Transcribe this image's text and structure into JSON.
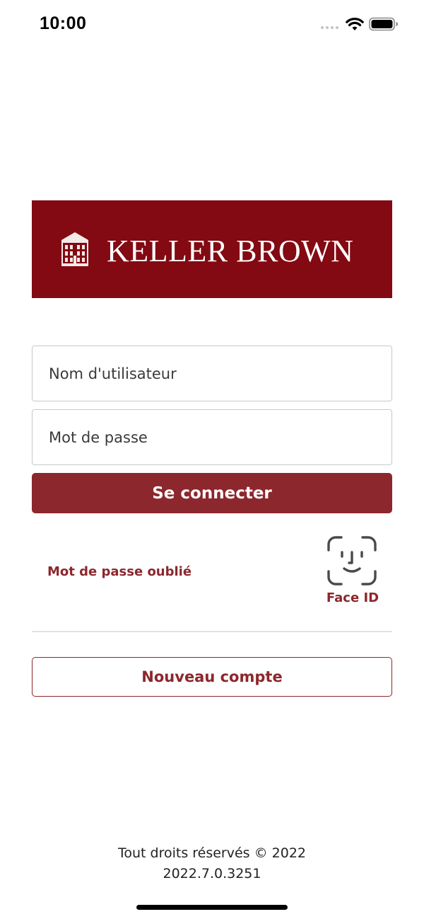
{
  "status_bar": {
    "time": "10:00",
    "icons": [
      "signal-dots-icon",
      "wifi-icon",
      "battery-icon"
    ]
  },
  "logo": {
    "text": "KELLER BROWN",
    "icon": "building-icon",
    "background_color": "#830912"
  },
  "form": {
    "username_placeholder": "Nom d'utilisateur",
    "username_value": "",
    "password_placeholder": "Mot de passe",
    "password_value": "",
    "login_label": "Se connecter"
  },
  "forgot_password_label": "Mot de passe oublié",
  "face_id": {
    "label": "Face ID",
    "icon": "face-id-icon"
  },
  "new_account_label": "Nouveau compte",
  "footer": {
    "copyright": "Tout droits réservés © 2022",
    "version": "2022.7.0.3251"
  },
  "colors": {
    "brand": "#8c272d",
    "banner": "#830912",
    "border": "#c8c8c8",
    "divider": "#e1e1e1"
  }
}
